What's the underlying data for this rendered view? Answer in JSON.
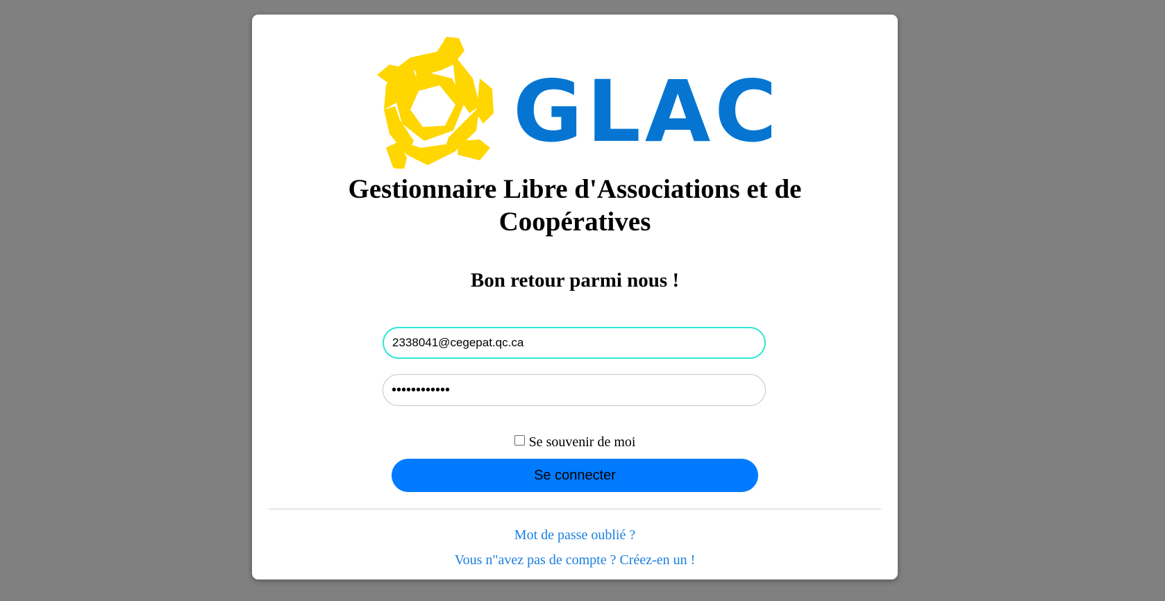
{
  "branding": {
    "logo_text": "GLAC",
    "logo_yellow": "#ffd600",
    "logo_blue": "#0575d1",
    "title_line1": "Gestionnaire Libre d'Associations et de",
    "title_line2": "Coopératives"
  },
  "login": {
    "heading": "Bon retour parmi nous !",
    "required_mark": "*",
    "email_value": "2338041@cegepat.qc.ca",
    "password_value": "••••••••••••",
    "remember_label": "Se souvenir de moi",
    "submit_label": "Se connecter",
    "forgot_link": "Mot de passe oublié ?",
    "create_link": "Vous n\"avez pas de compte ? Créez-en un !"
  },
  "colors": {
    "background": "#808080",
    "button": "#007bff",
    "focus_border": "#2ee6d6",
    "link": "#1a7fe0"
  }
}
